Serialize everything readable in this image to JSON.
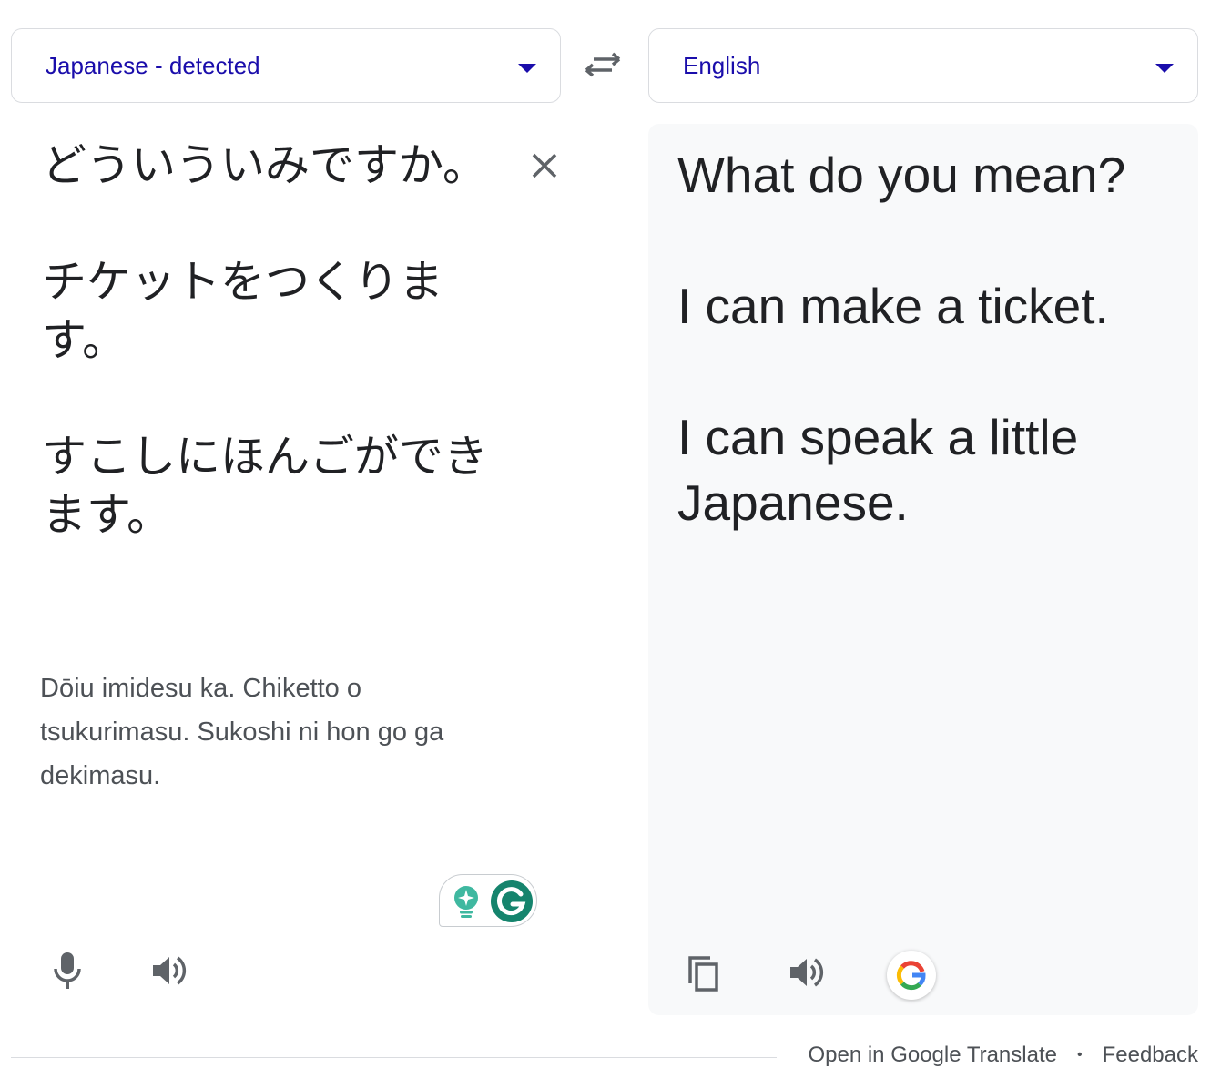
{
  "source_language": {
    "label": "Japanese - detected"
  },
  "target_language": {
    "label": "English"
  },
  "source_text": [
    "どういういみですか。",
    "チケットをつくります。",
    "すこしにほんごができます。"
  ],
  "romanization": "Dōiu imidesu ka. Chiketto o tsukurimasu. Sukoshi ni hon go ga dekimasu.",
  "translation": [
    "What do you mean?",
    "I can make a ticket.",
    "I can speak a little Japanese."
  ],
  "footer": {
    "open_link": "Open in Google Translate",
    "separator": "•",
    "feedback_link": "Feedback"
  },
  "colors": {
    "link_blue": "#1a0dab",
    "panel_bg": "#f8f9fa",
    "grammarly_green": "#15846d"
  },
  "icons": [
    "chevron-down-icon",
    "swap-icon",
    "close-icon",
    "grammarly-bulb-icon",
    "grammarly-logo-icon",
    "microphone-icon",
    "speaker-icon",
    "copy-icon",
    "google-icon"
  ]
}
